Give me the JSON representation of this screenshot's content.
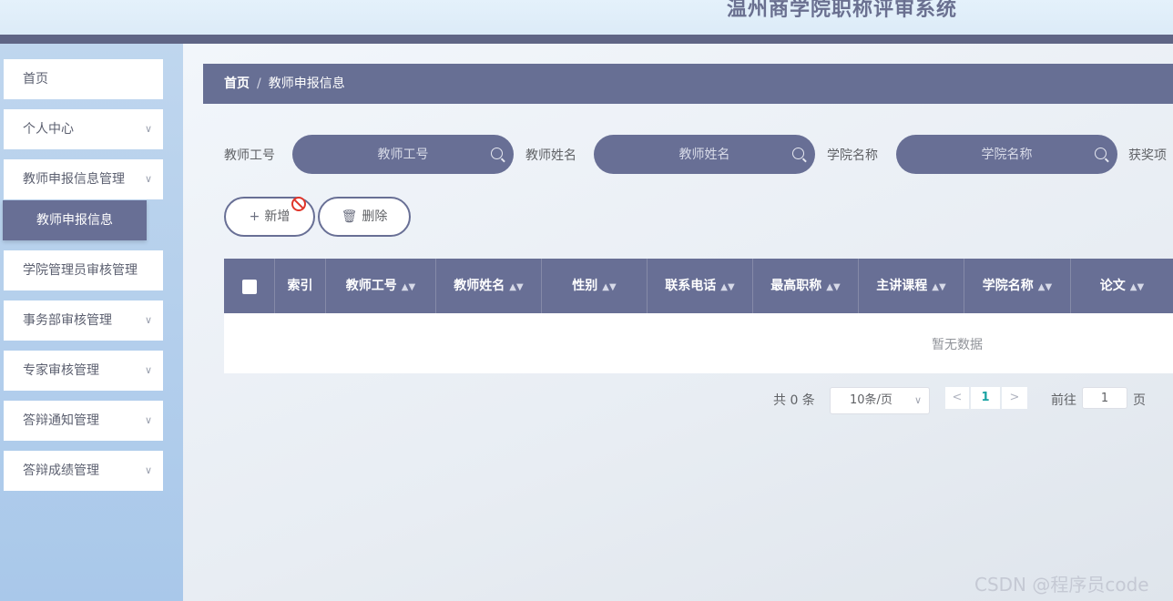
{
  "header": {
    "title": "温州商学院职称评审系统"
  },
  "sidebar": {
    "items": [
      {
        "label": "首页",
        "has_chevron": false
      },
      {
        "label": "个人中心",
        "has_chevron": true
      },
      {
        "label": "教师申报信息管理",
        "has_chevron": true
      },
      {
        "label": "学院管理员审核管理",
        "has_chevron": true
      },
      {
        "label": "事务部审核管理",
        "has_chevron": true
      },
      {
        "label": "专家审核管理",
        "has_chevron": true
      },
      {
        "label": "答辩通知管理",
        "has_chevron": true
      },
      {
        "label": "答辩成绩管理",
        "has_chevron": true
      }
    ],
    "active_submenu": "教师申报信息"
  },
  "breadcrumb": {
    "home": "首页",
    "separator": "/",
    "current": "教师申报信息"
  },
  "search": {
    "fields": [
      {
        "label": "教师工号",
        "placeholder": "教师工号"
      },
      {
        "label": "教师姓名",
        "placeholder": "教师姓名"
      },
      {
        "label": "学院名称",
        "placeholder": "学院名称"
      },
      {
        "label": "获奖项"
      }
    ]
  },
  "toolbar": {
    "add_label": "新增",
    "delete_label": "删除"
  },
  "table": {
    "columns": [
      "索引",
      "教师工号",
      "教师姓名",
      "性别",
      "联系电话",
      "最高职称",
      "主讲课程",
      "学院名称",
      "论文"
    ],
    "empty_text": "暂无数据"
  },
  "pagination": {
    "total_text": "共 0 条",
    "page_size": "10条/页",
    "current_page": "1",
    "goto_label": "前往",
    "goto_value": "1",
    "goto_unit": "页"
  },
  "watermark": "CSDN @程序员code",
  "colors": {
    "accent": "#686f95",
    "top_border": "#5f6585",
    "page_active": "#1aa3a3"
  }
}
